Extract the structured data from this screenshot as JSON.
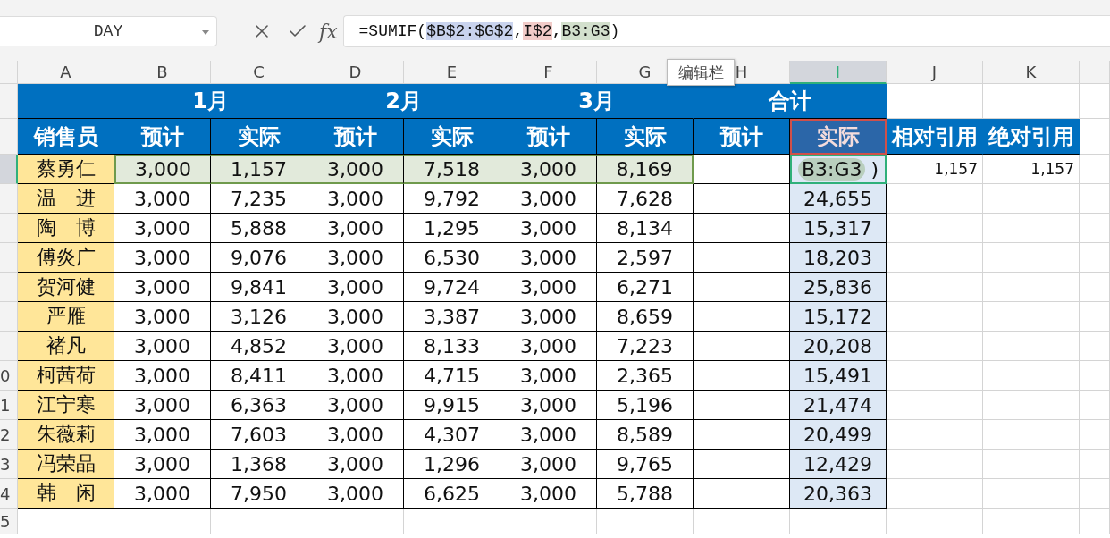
{
  "formula_bar": {
    "name_box": "DAY",
    "fx": "fx",
    "parts": [
      {
        "text": "=SUMIF(",
        "kind": "plain"
      },
      {
        "text": "$B$2:$G$2",
        "kind": "ref",
        "color": "#c9d3ee"
      },
      {
        "text": ",",
        "kind": "plain"
      },
      {
        "text": "I$2",
        "kind": "ref",
        "color": "#f1cbc8"
      },
      {
        "text": ",",
        "kind": "plain"
      },
      {
        "text": "B3:G3",
        "kind": "ref",
        "color": "#d3e0cd"
      },
      {
        "text": ")",
        "kind": "plain"
      }
    ]
  },
  "tooltip": "编辑栏",
  "columns": [
    {
      "label": "A",
      "selected": false
    },
    {
      "label": "B",
      "selected": false
    },
    {
      "label": "C",
      "selected": false
    },
    {
      "label": "D",
      "selected": false
    },
    {
      "label": "E",
      "selected": false
    },
    {
      "label": "F",
      "selected": false
    },
    {
      "label": "G",
      "selected": false
    },
    {
      "label": "H",
      "selected": false
    },
    {
      "label": "I",
      "selected": true
    },
    {
      "label": "J",
      "selected": false
    },
    {
      "label": "K",
      "selected": false
    }
  ],
  "row_headers": [
    {
      "selected": false
    },
    {
      "selected": false
    },
    {
      "selected": true
    },
    {
      "selected": false
    },
    {
      "selected": false
    },
    {
      "selected": false
    },
    {
      "selected": false
    },
    {
      "selected": false
    },
    {
      "selected": false
    },
    {
      "label": "0",
      "selected": false
    },
    {
      "label": "1",
      "selected": false
    },
    {
      "label": "2",
      "selected": false
    },
    {
      "label": "3",
      "selected": false
    },
    {
      "label": "4",
      "selected": false
    },
    {
      "label": "5",
      "selected": false
    }
  ],
  "months": [
    "1月",
    "2月",
    "3月"
  ],
  "total_title": "合计",
  "name_heading": "销售员",
  "sub_headings": [
    "预计",
    "实际",
    "预计",
    "实际",
    "预计",
    "实际",
    "预计",
    "实际"
  ],
  "extra_headings": [
    "相对引用",
    "绝对引用"
  ],
  "editing": {
    "ref": "B3:G3",
    "rest": ")"
  },
  "results": [
    "1,157",
    "1,157"
  ],
  "rows": [
    {
      "name": "蔡勇仁",
      "values": [
        "3,000",
        "1,157",
        "3,000",
        "7,518",
        "3,000",
        "8,169"
      ],
      "highlighted": true
    },
    {
      "name": "温　进",
      "values": [
        "3,000",
        "7,235",
        "3,000",
        "9,792",
        "3,000",
        "7,628"
      ],
      "total": "24,655",
      "highlighted": false
    },
    {
      "name": "陶　博",
      "values": [
        "3,000",
        "5,888",
        "3,000",
        "1,295",
        "3,000",
        "8,134"
      ],
      "total": "15,317",
      "highlighted": false
    },
    {
      "name": "傅炎广",
      "values": [
        "3,000",
        "9,076",
        "3,000",
        "6,530",
        "3,000",
        "2,597"
      ],
      "total": "18,203",
      "highlighted": false
    },
    {
      "name": "贺河健",
      "values": [
        "3,000",
        "9,841",
        "3,000",
        "9,724",
        "3,000",
        "6,271"
      ],
      "total": "25,836",
      "highlighted": false
    },
    {
      "name": "严雁",
      "values": [
        "3,000",
        "3,126",
        "3,000",
        "3,387",
        "3,000",
        "8,659"
      ],
      "total": "15,172",
      "highlighted": false
    },
    {
      "name": "褚凡",
      "values": [
        "3,000",
        "4,852",
        "3,000",
        "8,133",
        "3,000",
        "7,223"
      ],
      "total": "20,208",
      "highlighted": false
    },
    {
      "name": "柯茜荷",
      "values": [
        "3,000",
        "8,411",
        "3,000",
        "4,715",
        "3,000",
        "2,365"
      ],
      "total": "15,491",
      "highlighted": false
    },
    {
      "name": "江宁寒",
      "values": [
        "3,000",
        "6,363",
        "3,000",
        "9,915",
        "3,000",
        "5,196"
      ],
      "total": "21,474",
      "highlighted": false
    },
    {
      "name": "朱薇莉",
      "values": [
        "3,000",
        "7,603",
        "3,000",
        "4,307",
        "3,000",
        "8,589"
      ],
      "total": "20,499",
      "highlighted": false
    },
    {
      "name": "冯荣晶",
      "values": [
        "3,000",
        "1,368",
        "3,000",
        "1,296",
        "3,000",
        "9,765"
      ],
      "total": "12,429",
      "highlighted": false
    },
    {
      "name": "韩　闲",
      "values": [
        "3,000",
        "7,950",
        "3,000",
        "6,625",
        "3,000",
        "5,788"
      ],
      "total": "20,363",
      "highlighted": false
    }
  ]
}
